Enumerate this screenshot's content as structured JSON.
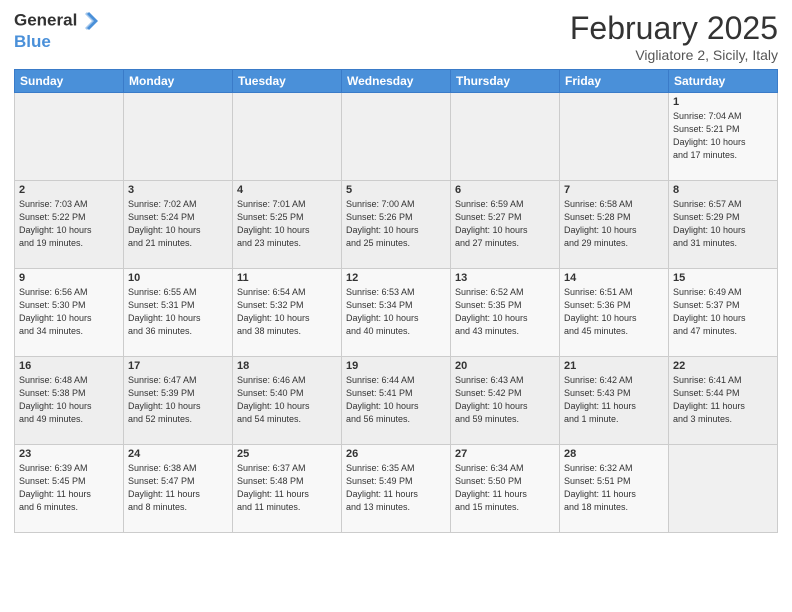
{
  "header": {
    "logo_text_general": "General",
    "logo_text_blue": "Blue",
    "month": "February 2025",
    "location": "Vigliatore 2, Sicily, Italy"
  },
  "weekdays": [
    "Sunday",
    "Monday",
    "Tuesday",
    "Wednesday",
    "Thursday",
    "Friday",
    "Saturday"
  ],
  "weeks": [
    [
      {
        "day": "",
        "info": ""
      },
      {
        "day": "",
        "info": ""
      },
      {
        "day": "",
        "info": ""
      },
      {
        "day": "",
        "info": ""
      },
      {
        "day": "",
        "info": ""
      },
      {
        "day": "",
        "info": ""
      },
      {
        "day": "1",
        "info": "Sunrise: 7:04 AM\nSunset: 5:21 PM\nDaylight: 10 hours\nand 17 minutes."
      }
    ],
    [
      {
        "day": "2",
        "info": "Sunrise: 7:03 AM\nSunset: 5:22 PM\nDaylight: 10 hours\nand 19 minutes."
      },
      {
        "day": "3",
        "info": "Sunrise: 7:02 AM\nSunset: 5:24 PM\nDaylight: 10 hours\nand 21 minutes."
      },
      {
        "day": "4",
        "info": "Sunrise: 7:01 AM\nSunset: 5:25 PM\nDaylight: 10 hours\nand 23 minutes."
      },
      {
        "day": "5",
        "info": "Sunrise: 7:00 AM\nSunset: 5:26 PM\nDaylight: 10 hours\nand 25 minutes."
      },
      {
        "day": "6",
        "info": "Sunrise: 6:59 AM\nSunset: 5:27 PM\nDaylight: 10 hours\nand 27 minutes."
      },
      {
        "day": "7",
        "info": "Sunrise: 6:58 AM\nSunset: 5:28 PM\nDaylight: 10 hours\nand 29 minutes."
      },
      {
        "day": "8",
        "info": "Sunrise: 6:57 AM\nSunset: 5:29 PM\nDaylight: 10 hours\nand 31 minutes."
      }
    ],
    [
      {
        "day": "9",
        "info": "Sunrise: 6:56 AM\nSunset: 5:30 PM\nDaylight: 10 hours\nand 34 minutes."
      },
      {
        "day": "10",
        "info": "Sunrise: 6:55 AM\nSunset: 5:31 PM\nDaylight: 10 hours\nand 36 minutes."
      },
      {
        "day": "11",
        "info": "Sunrise: 6:54 AM\nSunset: 5:32 PM\nDaylight: 10 hours\nand 38 minutes."
      },
      {
        "day": "12",
        "info": "Sunrise: 6:53 AM\nSunset: 5:34 PM\nDaylight: 10 hours\nand 40 minutes."
      },
      {
        "day": "13",
        "info": "Sunrise: 6:52 AM\nSunset: 5:35 PM\nDaylight: 10 hours\nand 43 minutes."
      },
      {
        "day": "14",
        "info": "Sunrise: 6:51 AM\nSunset: 5:36 PM\nDaylight: 10 hours\nand 45 minutes."
      },
      {
        "day": "15",
        "info": "Sunrise: 6:49 AM\nSunset: 5:37 PM\nDaylight: 10 hours\nand 47 minutes."
      }
    ],
    [
      {
        "day": "16",
        "info": "Sunrise: 6:48 AM\nSunset: 5:38 PM\nDaylight: 10 hours\nand 49 minutes."
      },
      {
        "day": "17",
        "info": "Sunrise: 6:47 AM\nSunset: 5:39 PM\nDaylight: 10 hours\nand 52 minutes."
      },
      {
        "day": "18",
        "info": "Sunrise: 6:46 AM\nSunset: 5:40 PM\nDaylight: 10 hours\nand 54 minutes."
      },
      {
        "day": "19",
        "info": "Sunrise: 6:44 AM\nSunset: 5:41 PM\nDaylight: 10 hours\nand 56 minutes."
      },
      {
        "day": "20",
        "info": "Sunrise: 6:43 AM\nSunset: 5:42 PM\nDaylight: 10 hours\nand 59 minutes."
      },
      {
        "day": "21",
        "info": "Sunrise: 6:42 AM\nSunset: 5:43 PM\nDaylight: 11 hours\nand 1 minute."
      },
      {
        "day": "22",
        "info": "Sunrise: 6:41 AM\nSunset: 5:44 PM\nDaylight: 11 hours\nand 3 minutes."
      }
    ],
    [
      {
        "day": "23",
        "info": "Sunrise: 6:39 AM\nSunset: 5:45 PM\nDaylight: 11 hours\nand 6 minutes."
      },
      {
        "day": "24",
        "info": "Sunrise: 6:38 AM\nSunset: 5:47 PM\nDaylight: 11 hours\nand 8 minutes."
      },
      {
        "day": "25",
        "info": "Sunrise: 6:37 AM\nSunset: 5:48 PM\nDaylight: 11 hours\nand 11 minutes."
      },
      {
        "day": "26",
        "info": "Sunrise: 6:35 AM\nSunset: 5:49 PM\nDaylight: 11 hours\nand 13 minutes."
      },
      {
        "day": "27",
        "info": "Sunrise: 6:34 AM\nSunset: 5:50 PM\nDaylight: 11 hours\nand 15 minutes."
      },
      {
        "day": "28",
        "info": "Sunrise: 6:32 AM\nSunset: 5:51 PM\nDaylight: 11 hours\nand 18 minutes."
      },
      {
        "day": "",
        "info": ""
      }
    ]
  ]
}
